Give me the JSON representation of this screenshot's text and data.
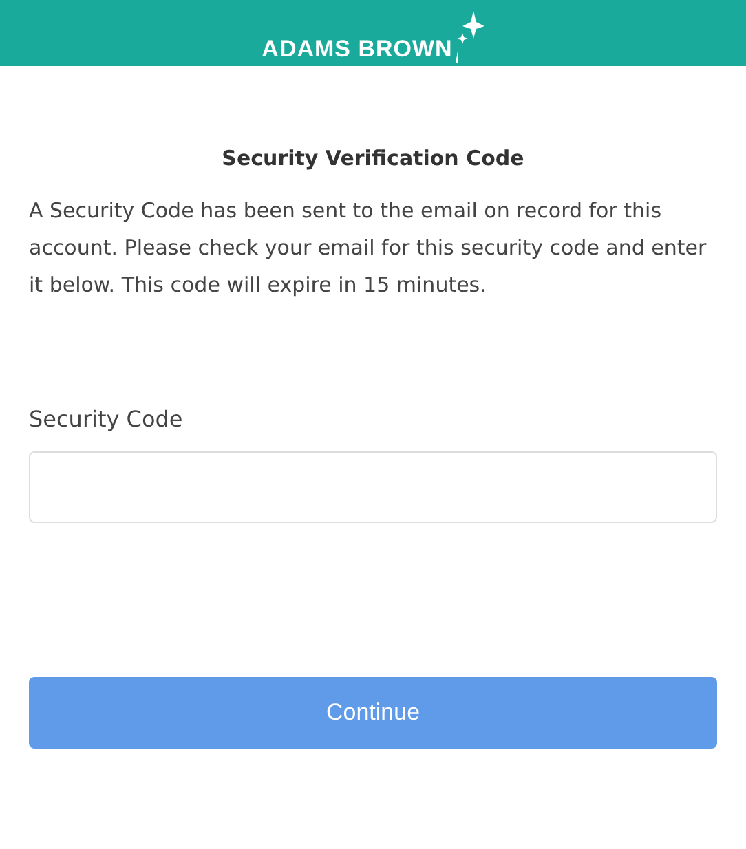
{
  "header": {
    "logo_text": "ADAMS BROWN"
  },
  "title": "Security Verification Code",
  "message": "A Security Code has been sent to the email on record for this account. Please check your email for this security code and enter it below. This code will expire in 15 minutes.",
  "field": {
    "label": "Security Code"
  },
  "button": {
    "label": "Continue"
  }
}
